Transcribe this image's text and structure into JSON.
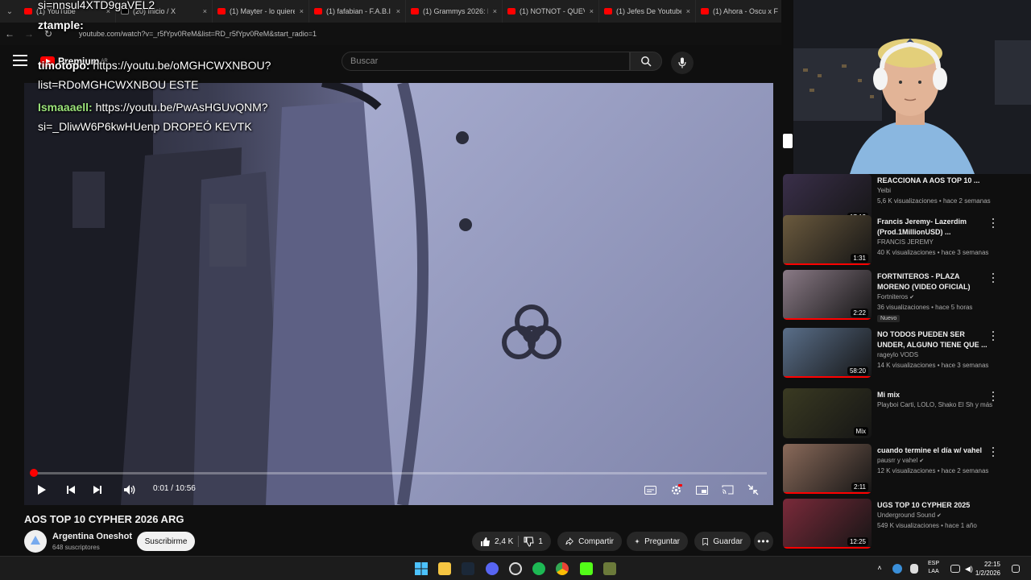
{
  "browser": {
    "tabs": [
      {
        "label": "(1) YouTube",
        "kind": "yt"
      },
      {
        "label": "(20) Inicio / X",
        "kind": "x"
      },
      {
        "label": "(1) Mayter - lo quiere",
        "kind": "yt"
      },
      {
        "label": "(1) fafabian - F.A.B.I",
        "kind": "yt"
      },
      {
        "label": "(1) Grammys 2026: Li",
        "kind": "yt"
      },
      {
        "label": "(1) NOTNOT - QUEVE",
        "kind": "yt"
      },
      {
        "label": "(1) Jefes De Youtube",
        "kind": "yt"
      },
      {
        "label": "(1) Ahora - Oscu x Fl",
        "kind": "yt"
      }
    ],
    "close_glyph": "×",
    "url": "youtube.com/watch?v=_r5fYpv0ReM&list=RD_r5fYpv0ReM&start_radio=1"
  },
  "yt_header": {
    "logo_text": "Premium",
    "region": "AR",
    "search_placeholder": "Buscar"
  },
  "chat": [
    {
      "user": "",
      "text": "si=nnsul4XTD9gaVEL2",
      "user_color": "#ffffff"
    },
    {
      "user": "ztample:",
      "text": "",
      "user_color": "#ffffff"
    },
    {
      "user": "timotopo:",
      "text": " https://youtu.be/oMGHCWXNBOU?",
      "user_color": "#ffffff"
    },
    {
      "user": "",
      "text": "list=RDoMGHCWXNBOU ESTE",
      "user_color": "#ffffff"
    },
    {
      "user": "Ismaaaell:",
      "text": " https://youtu.be/PwAsHGUvQNM?",
      "user_color": "#9be37a"
    },
    {
      "user": "",
      "text": "si=_DliwW6P6kwHUenp DROPEÓ KEVTK",
      "user_color": "#ffffff"
    }
  ],
  "player": {
    "progress": 0.002,
    "time": "0:01 / 10:56"
  },
  "video": {
    "title": "AOS TOP 10 CYPHER 2026 ARG",
    "channel": "Argentina Oneshot",
    "subscribers": "648 suscriptores",
    "subscribe_label": "Suscribirme",
    "likes": "2,4 K",
    "dislikes": "1",
    "share_label": "Compartir",
    "ask_label": "Preguntar",
    "save_label": "Guardar"
  },
  "recommendations": [
    {
      "title": "REACCIONA A AOS TOP 10 ...",
      "channel": "Yeibi",
      "meta": "5,6 K visualizaciones • hace 2 semanas",
      "duration": "17:12",
      "thumb_color": "#3a2f4a",
      "verified": false
    },
    {
      "title": "Francis Jeremy- Lazerdim (Prod.1MillionUSD) ...",
      "channel": "FRANCIS JEREMY",
      "meta": "40 K visualizaciones • hace 3 semanas",
      "duration": "1:31",
      "thumb_color": "#6b5a3e",
      "verified": false
    },
    {
      "title": "FORTNITEROS - PLAZA MORENO (VIDEO OFICIAL)",
      "channel": "Fortniteros",
      "meta": "36 visualizaciones • hace 5 horas",
      "duration": "2:22",
      "thumb_color": "#8a7a86",
      "verified": true,
      "badge": "Nuevo"
    },
    {
      "title": "NO TODOS PUEDEN SER UNDER, ALGUNO TIENE QUE ...",
      "channel": "rageylo VODS",
      "meta": "14 K visualizaciones • hace 3 semanas",
      "duration": "58:20",
      "thumb_color": "#5a6f8a",
      "verified": false
    },
    {
      "title": "Mi mix",
      "channel": "Playboi Carti, LOLO, Shako El Sh y más",
      "meta": "",
      "duration": "Mix",
      "thumb_color": "#3a3a22",
      "verified": false
    },
    {
      "title": "cuando termine el día w/ vahel",
      "channel": "pausrr y vahel",
      "meta": "12 K visualizaciones • hace 2 semanas",
      "duration": "2:11",
      "thumb_color": "#8a6a5a",
      "verified": true
    },
    {
      "title": "UGS TOP 10 CYPHER 2025",
      "channel": "Underground Sound",
      "meta": "549 K visualizaciones • hace 1 año",
      "duration": "12:25",
      "thumb_color": "#7a2a3a",
      "verified": true
    }
  ],
  "taskbar": {
    "lang_top": "ESP",
    "lang_bottom": "LAA",
    "time": "22:15",
    "date": "1/2/2026"
  }
}
